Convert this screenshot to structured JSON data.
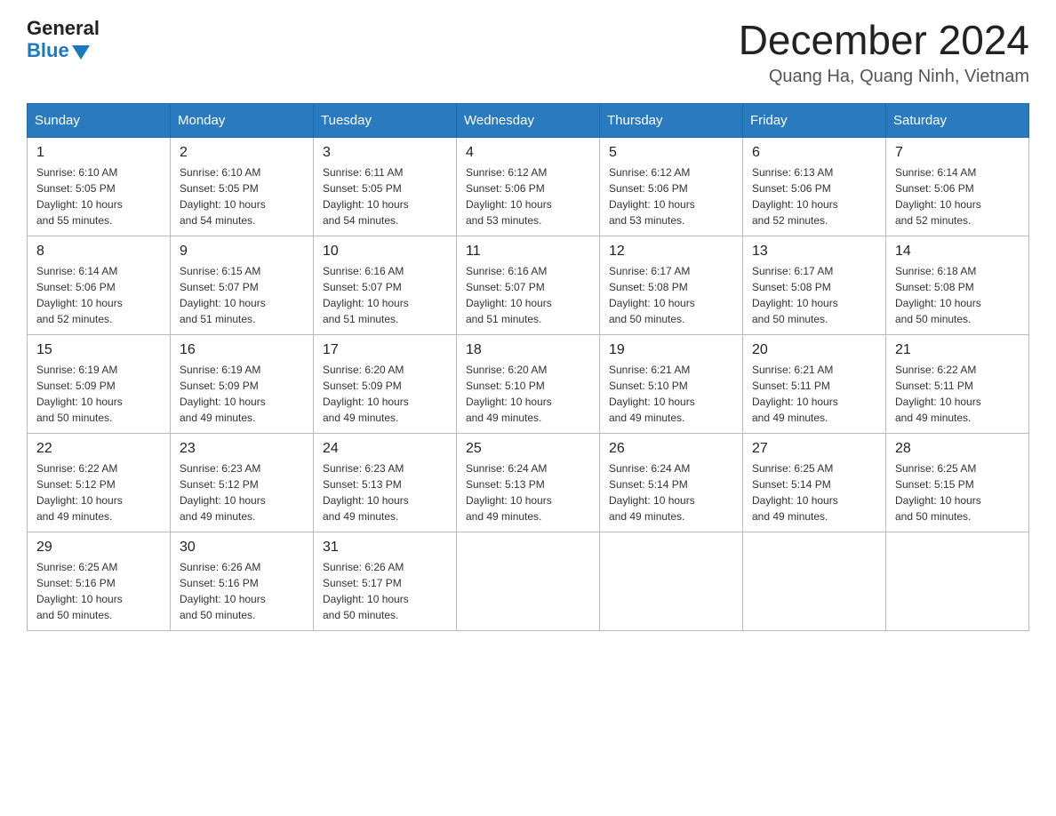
{
  "logo": {
    "general": "General",
    "blue": "Blue"
  },
  "title": {
    "month": "December 2024",
    "location": "Quang Ha, Quang Ninh, Vietnam"
  },
  "days_of_week": [
    "Sunday",
    "Monday",
    "Tuesday",
    "Wednesday",
    "Thursday",
    "Friday",
    "Saturday"
  ],
  "weeks": [
    [
      {
        "day": "1",
        "sunrise": "6:10 AM",
        "sunset": "5:05 PM",
        "daylight": "10 hours and 55 minutes."
      },
      {
        "day": "2",
        "sunrise": "6:10 AM",
        "sunset": "5:05 PM",
        "daylight": "10 hours and 54 minutes."
      },
      {
        "day": "3",
        "sunrise": "6:11 AM",
        "sunset": "5:05 PM",
        "daylight": "10 hours and 54 minutes."
      },
      {
        "day": "4",
        "sunrise": "6:12 AM",
        "sunset": "5:06 PM",
        "daylight": "10 hours and 53 minutes."
      },
      {
        "day": "5",
        "sunrise": "6:12 AM",
        "sunset": "5:06 PM",
        "daylight": "10 hours and 53 minutes."
      },
      {
        "day": "6",
        "sunrise": "6:13 AM",
        "sunset": "5:06 PM",
        "daylight": "10 hours and 52 minutes."
      },
      {
        "day": "7",
        "sunrise": "6:14 AM",
        "sunset": "5:06 PM",
        "daylight": "10 hours and 52 minutes."
      }
    ],
    [
      {
        "day": "8",
        "sunrise": "6:14 AM",
        "sunset": "5:06 PM",
        "daylight": "10 hours and 52 minutes."
      },
      {
        "day": "9",
        "sunrise": "6:15 AM",
        "sunset": "5:07 PM",
        "daylight": "10 hours and 51 minutes."
      },
      {
        "day": "10",
        "sunrise": "6:16 AM",
        "sunset": "5:07 PM",
        "daylight": "10 hours and 51 minutes."
      },
      {
        "day": "11",
        "sunrise": "6:16 AM",
        "sunset": "5:07 PM",
        "daylight": "10 hours and 51 minutes."
      },
      {
        "day": "12",
        "sunrise": "6:17 AM",
        "sunset": "5:08 PM",
        "daylight": "10 hours and 50 minutes."
      },
      {
        "day": "13",
        "sunrise": "6:17 AM",
        "sunset": "5:08 PM",
        "daylight": "10 hours and 50 minutes."
      },
      {
        "day": "14",
        "sunrise": "6:18 AM",
        "sunset": "5:08 PM",
        "daylight": "10 hours and 50 minutes."
      }
    ],
    [
      {
        "day": "15",
        "sunrise": "6:19 AM",
        "sunset": "5:09 PM",
        "daylight": "10 hours and 50 minutes."
      },
      {
        "day": "16",
        "sunrise": "6:19 AM",
        "sunset": "5:09 PM",
        "daylight": "10 hours and 49 minutes."
      },
      {
        "day": "17",
        "sunrise": "6:20 AM",
        "sunset": "5:09 PM",
        "daylight": "10 hours and 49 minutes."
      },
      {
        "day": "18",
        "sunrise": "6:20 AM",
        "sunset": "5:10 PM",
        "daylight": "10 hours and 49 minutes."
      },
      {
        "day": "19",
        "sunrise": "6:21 AM",
        "sunset": "5:10 PM",
        "daylight": "10 hours and 49 minutes."
      },
      {
        "day": "20",
        "sunrise": "6:21 AM",
        "sunset": "5:11 PM",
        "daylight": "10 hours and 49 minutes."
      },
      {
        "day": "21",
        "sunrise": "6:22 AM",
        "sunset": "5:11 PM",
        "daylight": "10 hours and 49 minutes."
      }
    ],
    [
      {
        "day": "22",
        "sunrise": "6:22 AM",
        "sunset": "5:12 PM",
        "daylight": "10 hours and 49 minutes."
      },
      {
        "day": "23",
        "sunrise": "6:23 AM",
        "sunset": "5:12 PM",
        "daylight": "10 hours and 49 minutes."
      },
      {
        "day": "24",
        "sunrise": "6:23 AM",
        "sunset": "5:13 PM",
        "daylight": "10 hours and 49 minutes."
      },
      {
        "day": "25",
        "sunrise": "6:24 AM",
        "sunset": "5:13 PM",
        "daylight": "10 hours and 49 minutes."
      },
      {
        "day": "26",
        "sunrise": "6:24 AM",
        "sunset": "5:14 PM",
        "daylight": "10 hours and 49 minutes."
      },
      {
        "day": "27",
        "sunrise": "6:25 AM",
        "sunset": "5:14 PM",
        "daylight": "10 hours and 49 minutes."
      },
      {
        "day": "28",
        "sunrise": "6:25 AM",
        "sunset": "5:15 PM",
        "daylight": "10 hours and 50 minutes."
      }
    ],
    [
      {
        "day": "29",
        "sunrise": "6:25 AM",
        "sunset": "5:16 PM",
        "daylight": "10 hours and 50 minutes."
      },
      {
        "day": "30",
        "sunrise": "6:26 AM",
        "sunset": "5:16 PM",
        "daylight": "10 hours and 50 minutes."
      },
      {
        "day": "31",
        "sunrise": "6:26 AM",
        "sunset": "5:17 PM",
        "daylight": "10 hours and 50 minutes."
      },
      null,
      null,
      null,
      null
    ]
  ],
  "labels": {
    "sunrise": "Sunrise:",
    "sunset": "Sunset:",
    "daylight": "Daylight:"
  }
}
